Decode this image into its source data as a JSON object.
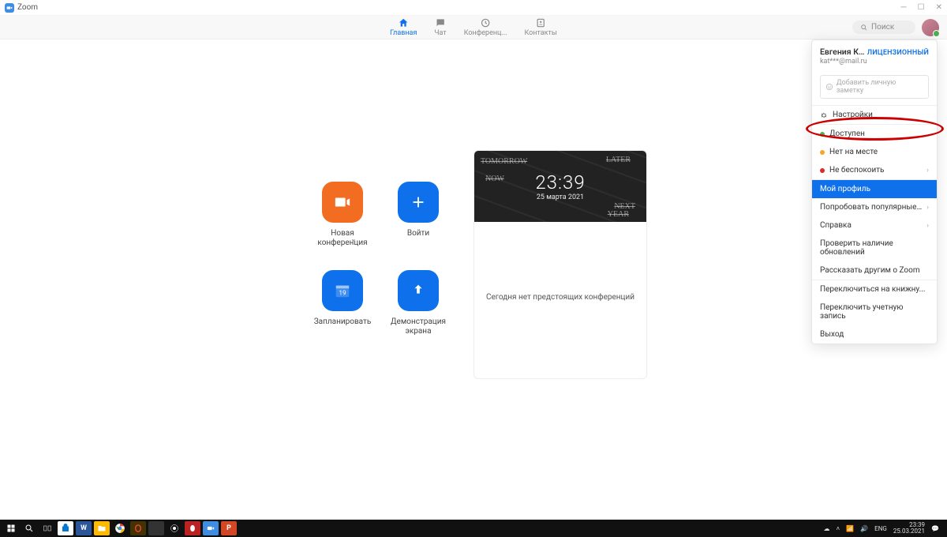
{
  "window": {
    "title": "Zoom"
  },
  "nav": {
    "home": "Главная",
    "chat": "Чат",
    "meetings": "Конференц...",
    "contacts": "Контакты",
    "search_placeholder": "Поиск"
  },
  "actions": {
    "new_meeting": "Новая\nконференция",
    "join": "Войти",
    "schedule": "Запланировать",
    "share": "Демонстрация\nэкрана",
    "calendar_day": "19"
  },
  "card": {
    "time": "23:39",
    "date": "25 марта 2021",
    "empty": "Сегодня нет предстоящих конференций",
    "chalk1": "TOMORROW",
    "chalk2": "LATER",
    "chalk3": "NEXT",
    "chalk4": "YEAR",
    "chalk5": "NOW"
  },
  "profile": {
    "name": "Евгения Кат...",
    "license": "ЛИЦЕНЗИОННЫЙ",
    "email": "kat***@mail.ru",
    "note_placeholder": "Добавить личную заметку",
    "settings": "Настройки",
    "status_available": "Доступен",
    "status_away": "Нет на месте",
    "status_dnd": "Не беспокоить",
    "my_profile": "Мой профиль",
    "try_features": "Попробовать популярные функции",
    "help": "Справка",
    "check_updates": "Проверить наличие обновлений",
    "tell_others": "Рассказать другим о Zoom",
    "switch_book": "Переключиться на книжну...",
    "switch_account": "Переключить учетную запись",
    "exit": "Выход"
  },
  "taskbar": {
    "lang": "ENG",
    "time": "23:39",
    "date": "25.03.2021"
  }
}
